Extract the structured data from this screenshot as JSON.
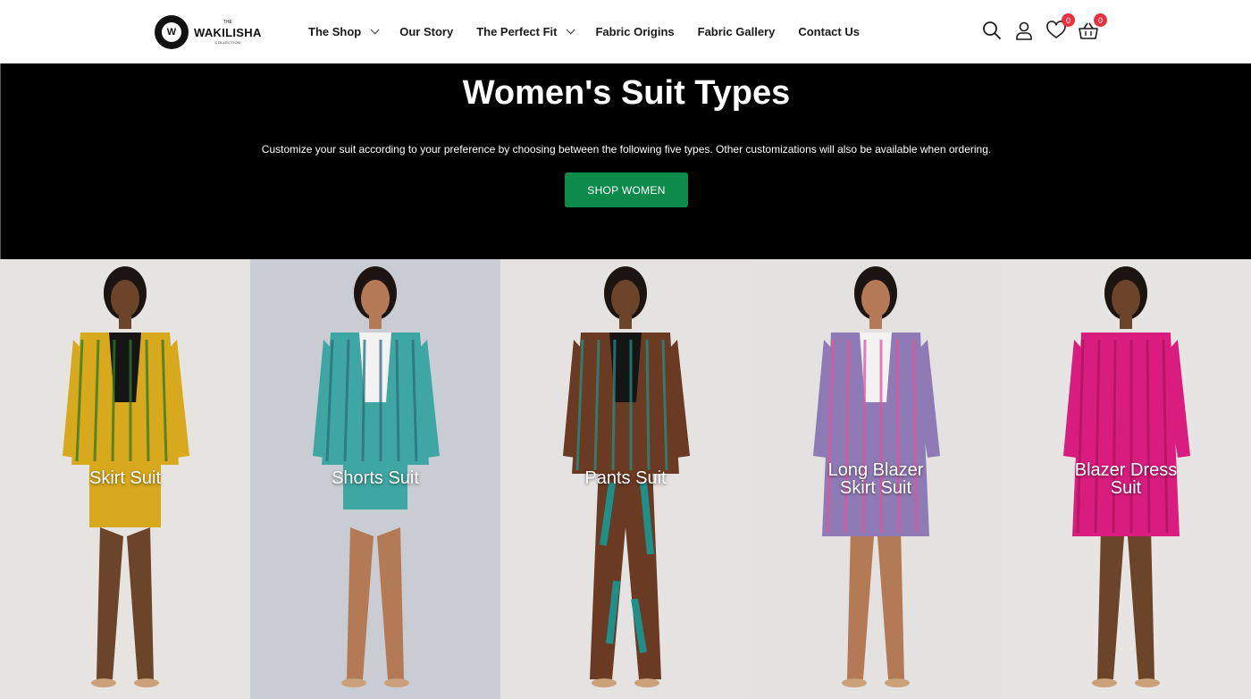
{
  "brand": {
    "the": "THE",
    "name": "WAKILISHA",
    "collection": "COLLECTION",
    "mark": "W"
  },
  "nav": [
    {
      "label": "The Shop",
      "has_dropdown": true
    },
    {
      "label": "Our Story",
      "has_dropdown": false
    },
    {
      "label": "The Perfect Fit",
      "has_dropdown": true
    },
    {
      "label": "Fabric Origins",
      "has_dropdown": false
    },
    {
      "label": "Fabric Gallery",
      "has_dropdown": false
    },
    {
      "label": "Contact Us",
      "has_dropdown": false
    }
  ],
  "header_icons": {
    "wishlist_count": "0",
    "cart_count": "0"
  },
  "hero": {
    "title": "Women's Suit Types",
    "description": "Customize your suit according to your preference by choosing between the following five types. Other customizations will also be available when ordering.",
    "button": "SHOP WOMEN"
  },
  "panels": [
    {
      "label": "Skirt Suit",
      "bg": "#e6e4e1",
      "suit": "#d8a91c",
      "accent": "#2d7a2a"
    },
    {
      "label": "Shorts Suit",
      "bg": "#c9ccd3",
      "suit": "#3fa7a3",
      "accent": "#2c6d7a"
    },
    {
      "label": "Pants Suit",
      "bg": "#e4e3e1",
      "suit": "#6b3a22",
      "accent": "#1f8f8a"
    },
    {
      "label": "Long Blazer\nSkirt Suit",
      "bg": "#e3e2e0",
      "suit": "#8e7bb5",
      "accent": "#e0559a"
    },
    {
      "label": "Blazer Dress\nSuit",
      "bg": "#e6e5e3",
      "suit": "#d81d7e",
      "accent": "#b0125f"
    }
  ],
  "colors": {
    "accent_green": "#0c8a4a",
    "badge_red": "#e5323e",
    "hero_bg": "#000000"
  }
}
